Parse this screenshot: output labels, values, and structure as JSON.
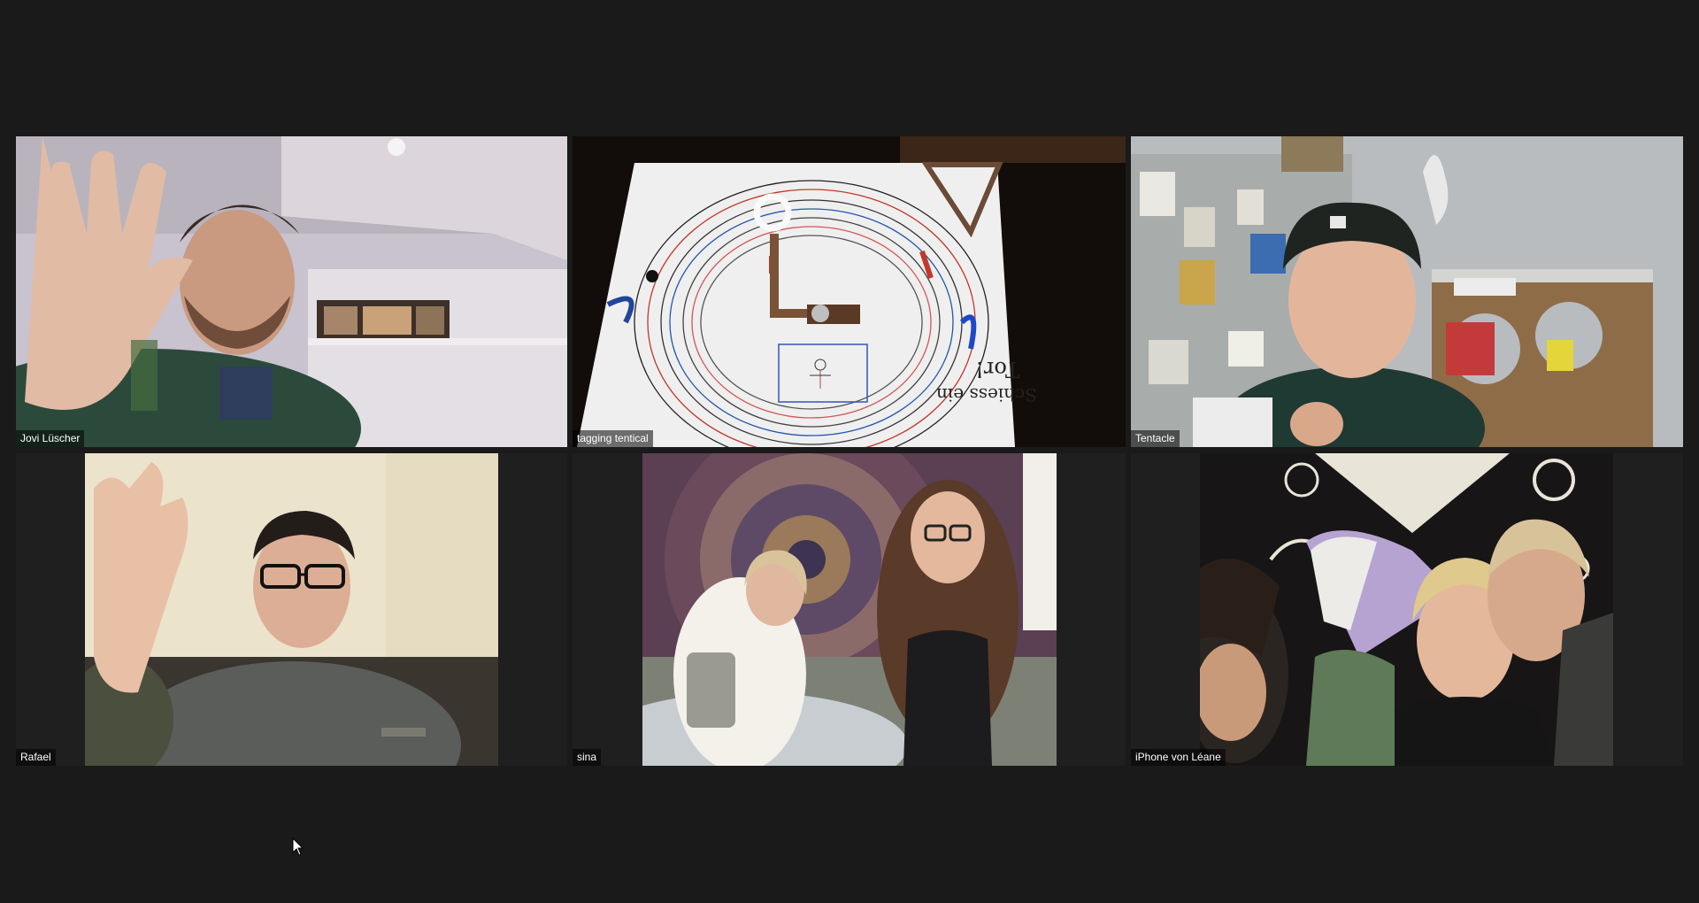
{
  "meeting": {
    "participants": [
      {
        "name": "Jovi Lüscher",
        "active_speaker": false
      },
      {
        "name": "tagging tentical",
        "active_speaker": true
      },
      {
        "name": "Tentacle",
        "active_speaker": false
      },
      {
        "name": "Rafael",
        "active_speaker": false
      },
      {
        "name": "sina",
        "active_speaker": false
      },
      {
        "name": "iPhone von Léane",
        "active_speaker": false
      }
    ],
    "active_speaker_color": "#d7e86b",
    "background_color": "#1a1a1a",
    "drawing_text": {
      "line1": "Schiess ein",
      "line2": "Tor!"
    }
  }
}
